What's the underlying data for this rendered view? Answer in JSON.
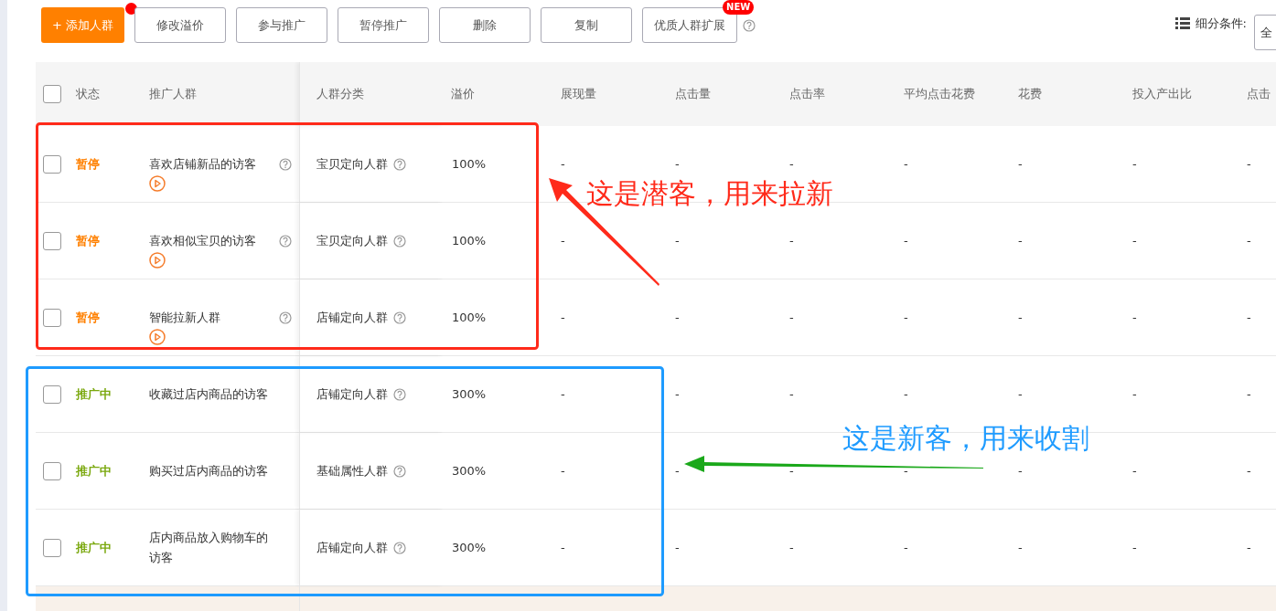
{
  "toolbar": {
    "buttons": [
      {
        "label": "+ 添加人群",
        "kind": "primary",
        "dot": true,
        "help": false
      },
      {
        "label": "修改溢价",
        "kind": "default",
        "dot": false,
        "help": false
      },
      {
        "label": "参与推广",
        "kind": "default",
        "dot": false,
        "help": false
      },
      {
        "label": "暂停推广",
        "kind": "default",
        "dot": false,
        "help": false
      },
      {
        "label": "删除",
        "kind": "default",
        "dot": false,
        "help": false
      },
      {
        "label": "复制",
        "kind": "default",
        "dot": false,
        "help": false
      },
      {
        "label": "优质人群扩展",
        "kind": "default",
        "dot": false,
        "badge": "NEW",
        "help": true
      }
    ],
    "filter_label": "细分条件:",
    "filter_value": "全"
  },
  "table": {
    "all_checked": false,
    "columns": [
      "状态",
      "推广人群",
      "人群分类",
      "溢价",
      "展现量",
      "点击量",
      "点击率",
      "平均点击花费",
      "花费",
      "投入产出比",
      "点击"
    ],
    "rows": [
      {
        "checked": false,
        "status": {
          "text": "暂停",
          "kind": "paused"
        },
        "name": "喜欢店铺新品的访客",
        "name_help": true,
        "play": true,
        "category": "宝贝定向人群",
        "premium": "100%",
        "metrics": [
          "-",
          "-",
          "-",
          "-",
          "-",
          "-",
          "-"
        ]
      },
      {
        "checked": false,
        "status": {
          "text": "暂停",
          "kind": "paused"
        },
        "name": "喜欢相似宝贝的访客",
        "name_help": true,
        "play": true,
        "category": "宝贝定向人群",
        "premium": "100%",
        "metrics": [
          "-",
          "-",
          "-",
          "-",
          "-",
          "-",
          "-"
        ]
      },
      {
        "checked": false,
        "status": {
          "text": "暂停",
          "kind": "paused"
        },
        "name": "智能拉新人群",
        "name_help": true,
        "play": true,
        "category": "店铺定向人群",
        "premium": "100%",
        "metrics": [
          "-",
          "-",
          "-",
          "-",
          "-",
          "-",
          "-"
        ]
      },
      {
        "checked": false,
        "status": {
          "text": "推广中",
          "kind": "active"
        },
        "name": "收藏过店内商品的访客",
        "name_help": false,
        "play": false,
        "category": "店铺定向人群",
        "premium": "300%",
        "metrics": [
          "-",
          "-",
          "-",
          "-",
          "-",
          "-",
          "-"
        ]
      },
      {
        "checked": false,
        "status": {
          "text": "推广中",
          "kind": "active"
        },
        "name": "购买过店内商品的访客",
        "name_help": false,
        "play": false,
        "category": "基础属性人群",
        "premium": "300%",
        "metrics": [
          "-",
          "-",
          "-",
          "-",
          "-",
          "-",
          "-"
        ]
      },
      {
        "checked": false,
        "status": {
          "text": "推广中",
          "kind": "active"
        },
        "name": "店内商品放入购物车的访客",
        "name_help": false,
        "play": false,
        "category": "店铺定向人群",
        "premium": "300%",
        "metrics": [
          "-",
          "-",
          "-",
          "-",
          "-",
          "-",
          "-"
        ]
      }
    ]
  },
  "annotations": [
    {
      "text": "这是潜客，用来拉新",
      "color": "#ff2a1a"
    },
    {
      "text": "这是新客，用来收割",
      "color": "#1e9bff"
    }
  ]
}
